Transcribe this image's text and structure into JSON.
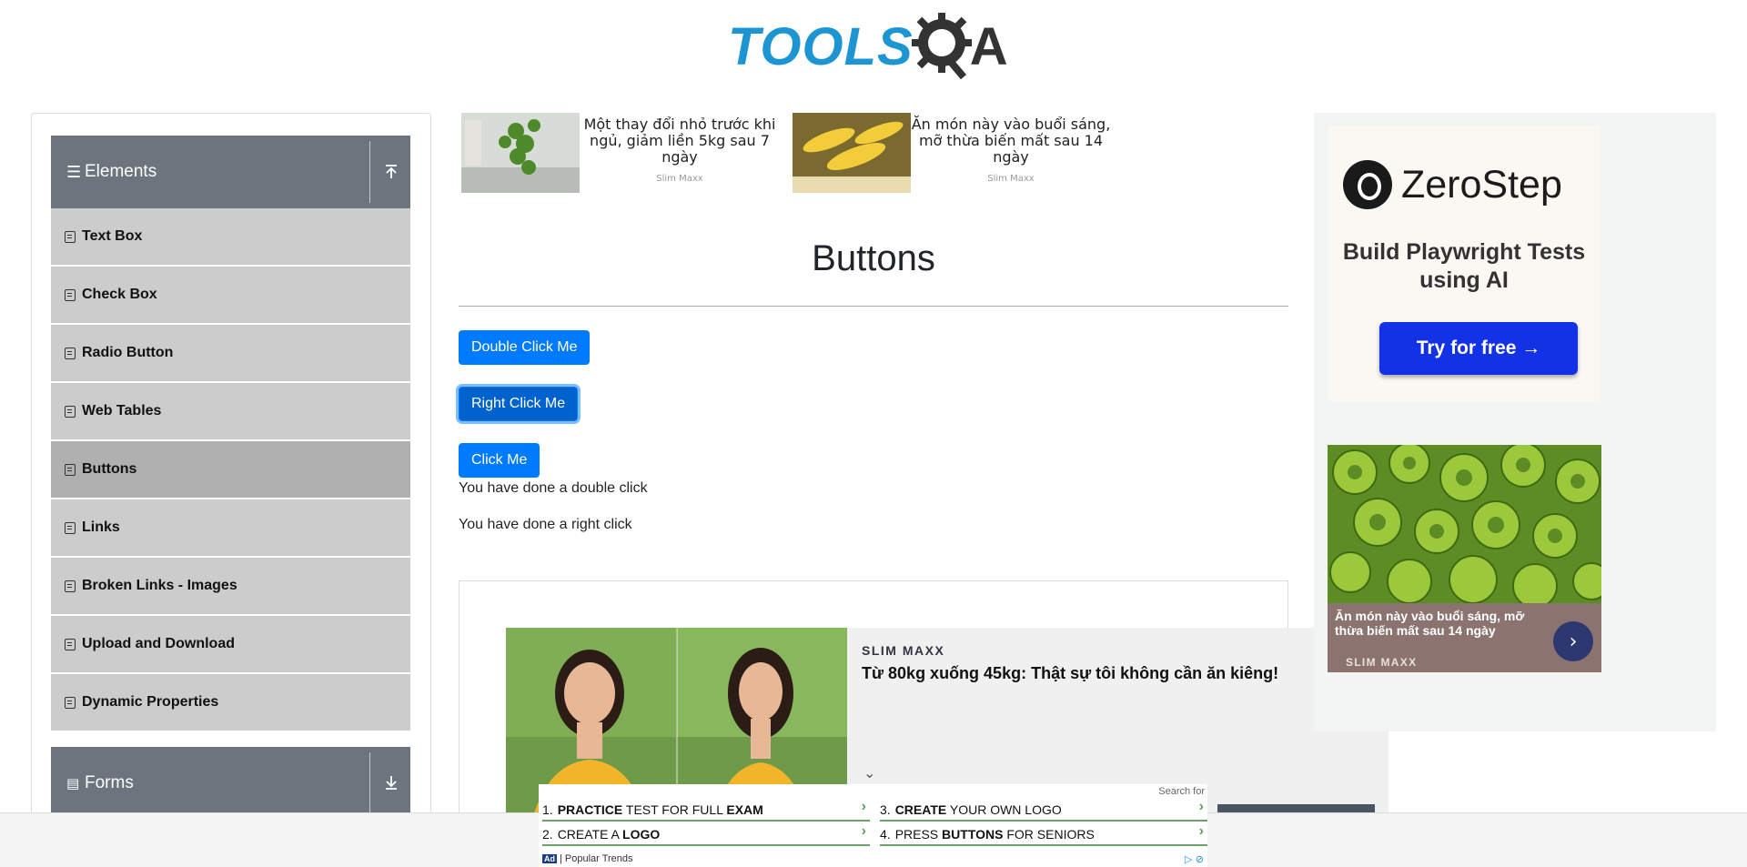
{
  "header": {
    "logo_text": "TOOLS",
    "logo_suffix": "A"
  },
  "sidebar": {
    "groups": [
      {
        "label": "Elements",
        "icon": "hamburger-icon",
        "toggle": "collapse-up-icon"
      },
      {
        "label": "Forms",
        "icon": "document-icon",
        "toggle": "expand-down-icon"
      }
    ],
    "items": [
      {
        "label": "Text Box"
      },
      {
        "label": "Check Box"
      },
      {
        "label": "Radio Button"
      },
      {
        "label": "Web Tables"
      },
      {
        "label": "Buttons",
        "active": true
      },
      {
        "label": "Links"
      },
      {
        "label": "Broken Links - Images"
      },
      {
        "label": "Upload and Download"
      },
      {
        "label": "Dynamic Properties"
      }
    ]
  },
  "top_ads": [
    {
      "text": "Một thay đổi nhỏ trước khi ngủ, giảm liền 5kg sau 7 ngày",
      "source": "Slim Maxx"
    },
    {
      "text": "Ăn món này vào buổi sáng, mỡ thừa biến mất sau 14 ngày",
      "source": "Slim Maxx"
    }
  ],
  "main": {
    "title": "Buttons",
    "double_click_label": "Double Click Me",
    "right_click_label": "Right Click Me",
    "click_label": "Click Me",
    "double_click_message": "You have done a double click",
    "right_click_message": "You have done a right click"
  },
  "mid_ad": {
    "sponsor": "SLIM MAXX",
    "headline": "Từ 80kg xuống 45kg: Thật sự tôi không cần ăn kiêng!",
    "chevron": "⌄"
  },
  "right_ad": {
    "brand": "ZeroStep",
    "tagline": "Build Playwright Tests using AI",
    "cta": "Try for free →",
    "card_caption": "Ăn món này vào buổi sáng, mỡ thừa biến mất sau 14 ngày",
    "card_brand": "SLIM MAXX",
    "card_arrow": "›"
  },
  "bottom_ad": {
    "search_for": "Search for",
    "links": [
      {
        "num": "1.",
        "bold": "PRACTICE",
        "rest": " TEST FOR FULL ",
        "bold2": "EXAM"
      },
      {
        "num": "2.",
        "bold": "",
        "rest": "CREATE A ",
        "bold2": "LOGO"
      },
      {
        "num": "3.",
        "bold": "CREATE",
        "rest": " YOUR OWN LOGO",
        "bold2": ""
      },
      {
        "num": "4.",
        "bold": "",
        "rest": "PRESS ",
        "bold2": "BUTTONS",
        "rest2": " FOR SENIORS"
      }
    ],
    "ad_label": "Ad",
    "popular": "Popular Trends",
    "arrow": "›"
  },
  "colors": {
    "primary": "#007bff",
    "sidebar_header": "#6c757d",
    "menu_item": "#cccccc",
    "logo_blue": "#1d95d2"
  }
}
